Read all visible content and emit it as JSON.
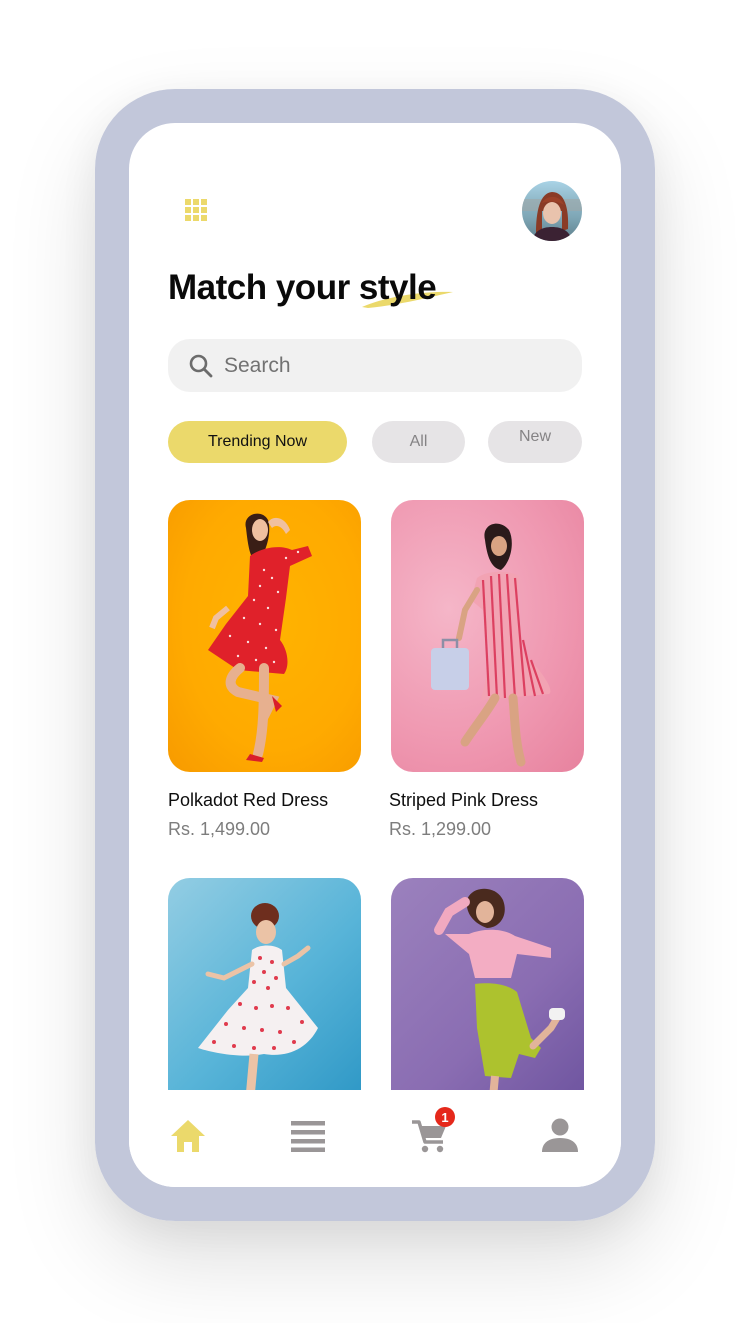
{
  "header": {
    "menu_icon": "grid-icon",
    "avatar_icon": "user-avatar",
    "title": "Match your style",
    "title_highlight_word": "style"
  },
  "search": {
    "placeholder": "Search",
    "value": "",
    "icon": "search-icon"
  },
  "filters": [
    {
      "label": "Trending Now",
      "active": true
    },
    {
      "label": "All",
      "active": false
    },
    {
      "label": "New",
      "active": false
    }
  ],
  "products": [
    {
      "name": "Polkadot Red Dress",
      "price": "Rs.  1,499.00",
      "background": "#ffaa00"
    },
    {
      "name": "Striped Pink Dress",
      "price": "Rs.  1,299.00",
      "background": "#ef97b0"
    },
    {
      "name": "",
      "price": "",
      "background": "#58b4d8"
    },
    {
      "name": "",
      "price": "",
      "background": "#8a6db2"
    }
  ],
  "bottom_nav": {
    "items": [
      {
        "icon": "home-icon",
        "active": true
      },
      {
        "icon": "menu-icon",
        "active": false
      },
      {
        "icon": "cart-icon",
        "active": false,
        "badge": "1"
      },
      {
        "icon": "profile-icon",
        "active": false
      }
    ]
  },
  "colors": {
    "accent": "#ebd96b",
    "frame": "#c2c7da",
    "badge": "#e5281b",
    "icon_inactive": "#9a9697",
    "pill_inactive": "#e6e4e6"
  }
}
